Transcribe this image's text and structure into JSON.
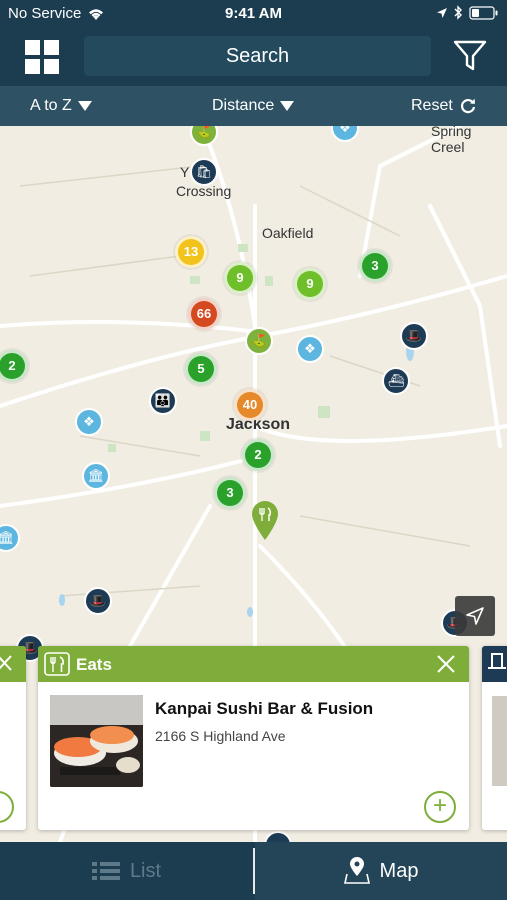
{
  "status_bar": {
    "carrier": "No Service",
    "time": "9:41 AM"
  },
  "header": {
    "search_label": "Search"
  },
  "sort_bar": {
    "sort_name": "A to Z",
    "sort_distance": "Distance",
    "reset": "Reset"
  },
  "map": {
    "labels": {
      "spring_creek": "Spring Creel",
      "ys_crossing_1": "Y    s",
      "ys_crossing_2": "Crossing",
      "oakfield": "Oakfield",
      "jackson": "Jackson"
    },
    "clusters": [
      {
        "count": "13",
        "color": "#f2c31b"
      },
      {
        "count": "9",
        "color": "#6fbf2a"
      },
      {
        "count": "9",
        "color": "#6fbf2a"
      },
      {
        "count": "3",
        "color": "#2aa12a"
      },
      {
        "count": "66",
        "color": "#d4491f"
      },
      {
        "count": "2",
        "color": "#2aa12a"
      },
      {
        "count": "5",
        "color": "#2aa12a"
      },
      {
        "count": "40",
        "color": "#e6892a"
      },
      {
        "count": "2",
        "color": "#2aa12a"
      },
      {
        "count": "3",
        "color": "#2aa12a"
      }
    ]
  },
  "card": {
    "category": "Eats",
    "name": "Kanpai Sushi Bar & Fusion",
    "address": "2166 S Highland Ave",
    "add_symbol": "+"
  },
  "tabs": {
    "list": "List",
    "map": "Map"
  },
  "colors": {
    "header": "#1c3d4f",
    "eats_green": "#7fad3a",
    "map_bg": "#f1ede3"
  }
}
